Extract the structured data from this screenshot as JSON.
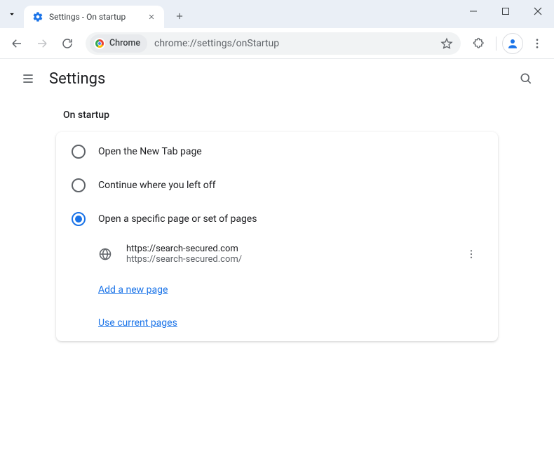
{
  "window": {
    "tab_title": "Settings - On startup"
  },
  "addressbar": {
    "chip_label": "Chrome",
    "url": "chrome://settings/onStartup"
  },
  "header": {
    "title": "Settings"
  },
  "section": {
    "title": "On startup"
  },
  "options": {
    "new_tab": "Open the New Tab page",
    "continue": "Continue where you left off",
    "specific": "Open a specific page or set of pages"
  },
  "startup_page": {
    "name": "https://search-secured.com",
    "url": "https://search-secured.com/"
  },
  "links": {
    "add_page": "Add a new page",
    "use_current": "Use current pages"
  }
}
